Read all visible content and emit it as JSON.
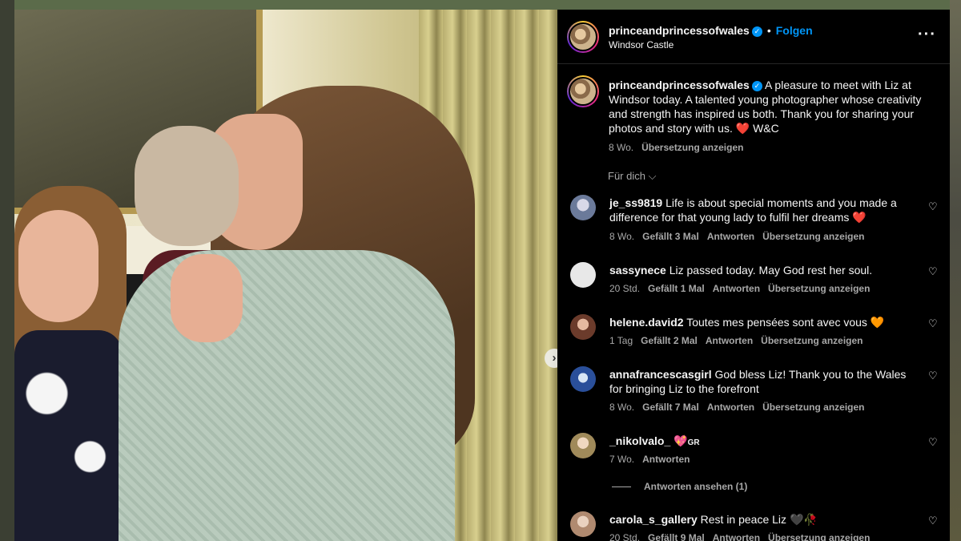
{
  "post": {
    "username": "princeandprincessofwales",
    "follow_label": "Folgen",
    "location": "Windsor Castle",
    "caption": "A pleasure to meet with Liz at Windsor today. A talented young photographer whose creativity and strength has inspired us both. Thank you for sharing your photos and story with us. ❤️ W&C",
    "caption_age": "8 Wo.",
    "translate_label": "Übersetzung anzeigen",
    "for_you_label": "Für dich"
  },
  "comments": [
    {
      "username": "je_ss9819",
      "text": "Life is about special moments and you made a difference for that young lady to fulfil her dreams",
      "emoji": "❤️",
      "age": "8 Wo.",
      "likes": "Gefällt 3 Mal",
      "reply": "Antworten",
      "translate": "Übersetzung anzeigen"
    },
    {
      "username": "sassynece",
      "text": "Liz passed today. May God rest her soul.",
      "age": "20 Std.",
      "likes": "Gefällt 1 Mal",
      "reply": "Antworten",
      "translate": "Übersetzung anzeigen"
    },
    {
      "username": "helene.david2",
      "text": "Toutes mes pensées sont avec vous",
      "emoji": "🧡",
      "age": "1 Tag",
      "likes": "Gefällt 2 Mal",
      "reply": "Antworten",
      "translate": "Übersetzung anzeigen"
    },
    {
      "username": "annafrancescasgirl",
      "text": "God bless Liz! Thank you to the Wales for bringing Liz to the forefront",
      "age": "8 Wo.",
      "likes": "Gefällt 7 Mal",
      "reply": "Antworten",
      "translate": "Übersetzung anzeigen"
    },
    {
      "username": "_nikolvalo_",
      "text": "GR",
      "emoji": "💖",
      "age": "7 Wo.",
      "reply": "Antworten",
      "view_replies": "Antworten ansehen (1)"
    },
    {
      "username": "carola_s_gallery",
      "text": "Rest in peace Liz",
      "emoji": "🖤🥀",
      "age": "20 Std.",
      "likes": "Gefällt 9 Mal",
      "reply": "Antworten",
      "translate": "Übersetzung anzeigen"
    }
  ],
  "icons": {
    "verified": "verified-badge-icon",
    "more": "more-options-icon",
    "heart": "heart-outline-icon",
    "chevron": "chevron-down-icon",
    "next": "chevron-right-icon"
  },
  "colors": {
    "panel_bg": "#000000",
    "link_blue": "#0095f6",
    "muted_text": "#a8a8a8"
  }
}
